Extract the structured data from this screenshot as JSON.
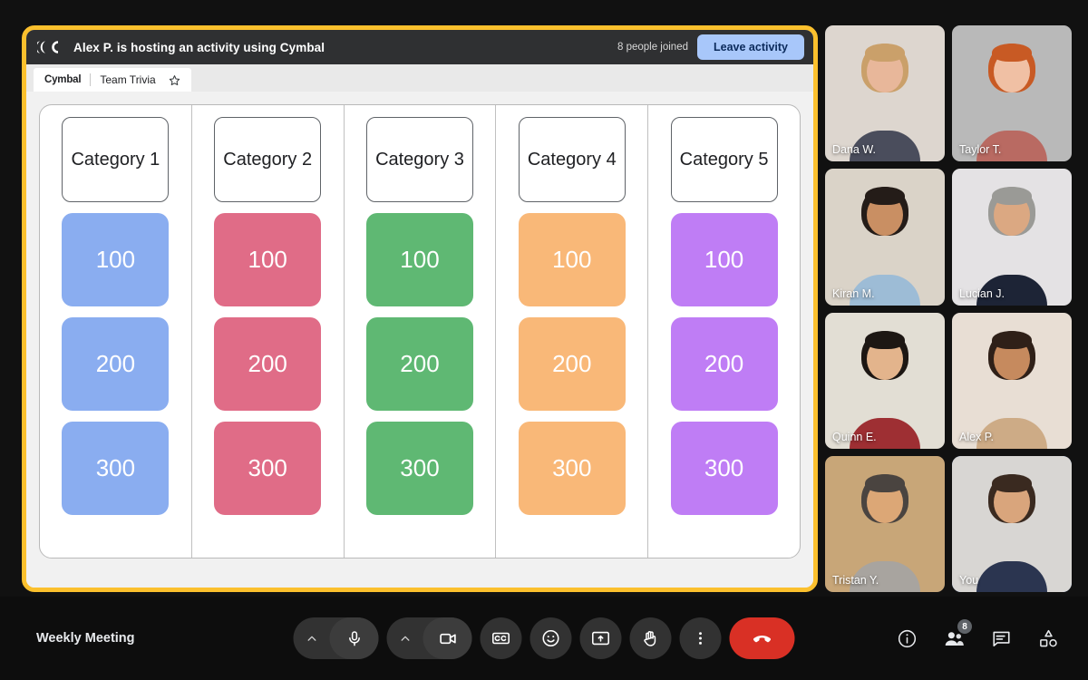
{
  "activity": {
    "logo_icon": "cymbal-logo-icon",
    "title": "Alex P. is hosting an activity using Cymbal",
    "joined_count": "8 people joined",
    "leave_label": "Leave activity",
    "tab": {
      "brand": "Cymbal",
      "doc_name": "Team Trivia",
      "star_icon": "star-outline-icon"
    },
    "border_color": "#FBC02D"
  },
  "board": {
    "columns": [
      {
        "category": "Category 1",
        "color": "#8aadf0",
        "values": [
          "100",
          "200",
          "300"
        ]
      },
      {
        "category": "Category 2",
        "color": "#e06c87",
        "values": [
          "100",
          "200",
          "300"
        ]
      },
      {
        "category": "Category 3",
        "color": "#5fb873",
        "values": [
          "100",
          "200",
          "300"
        ]
      },
      {
        "category": "Category 4",
        "color": "#f9b878",
        "values": [
          "100",
          "200",
          "300"
        ]
      },
      {
        "category": "Category 5",
        "color": "#bf7df5",
        "values": [
          "100",
          "200",
          "300"
        ]
      }
    ]
  },
  "participants": [
    {
      "name": "Dana W.",
      "is_you": false,
      "bg": "#ddd6cf",
      "skin": "#e8b79a",
      "hair": "#caa06a",
      "shirt": "#4a4d5c"
    },
    {
      "name": "Taylor T.",
      "is_you": false,
      "bg": "#b9b9b9",
      "skin": "#f0c0a4",
      "hair": "#c85a24",
      "shirt": "#b96a62"
    },
    {
      "name": "Kiran M.",
      "is_you": false,
      "bg": "#dad3c8",
      "skin": "#c98f63",
      "hair": "#241c18",
      "shirt": "#9dbcd6"
    },
    {
      "name": "Lucian J.",
      "is_you": false,
      "bg": "#e4e2e4",
      "skin": "#dba882",
      "hair": "#9a9a96",
      "shirt": "#1d2436"
    },
    {
      "name": "Quinn E.",
      "is_you": false,
      "bg": "#e2ded4",
      "skin": "#e3b48c",
      "hair": "#1d1713",
      "shirt": "#9e2f33"
    },
    {
      "name": "Alex P.",
      "is_you": false,
      "bg": "#e8ded4",
      "skin": "#c68a5e",
      "hair": "#2f2018",
      "shirt": "#cdab86"
    },
    {
      "name": "Tristan Y.",
      "is_you": false,
      "bg": "#c8a678",
      "skin": "#dca776",
      "hair": "#4a4440",
      "shirt": "#a8a49f"
    },
    {
      "name": "You",
      "is_you": true,
      "bg": "#d8d6d3",
      "skin": "#d9a57c",
      "hair": "#3a2a20",
      "shirt": "#2b3550"
    }
  ],
  "bottom_bar": {
    "meeting_name": "Weekly Meeting",
    "controls": [
      {
        "name": "microphone-button",
        "icon": "microphone-icon",
        "has_caret": true
      },
      {
        "name": "camera-button",
        "icon": "video-camera-icon",
        "has_caret": true
      },
      {
        "name": "captions-button",
        "icon": "closed-captions-icon"
      },
      {
        "name": "emoji-button",
        "icon": "emoji-smiley-icon"
      },
      {
        "name": "present-button",
        "icon": "present-screen-icon"
      },
      {
        "name": "raise-hand-button",
        "icon": "raised-hand-icon"
      },
      {
        "name": "more-options-button",
        "icon": "three-dots-vertical-icon"
      },
      {
        "name": "leave-call-button",
        "icon": "hang-up-phone-icon"
      }
    ],
    "right_controls": [
      {
        "name": "meeting-details-button",
        "icon": "info-circle-icon",
        "badge": ""
      },
      {
        "name": "people-panel-button",
        "icon": "people-icon",
        "badge": "8"
      },
      {
        "name": "chat-panel-button",
        "icon": "chat-bubble-icon",
        "badge": ""
      },
      {
        "name": "activities-panel-button",
        "icon": "activities-shapes-icon",
        "badge": ""
      }
    ]
  }
}
